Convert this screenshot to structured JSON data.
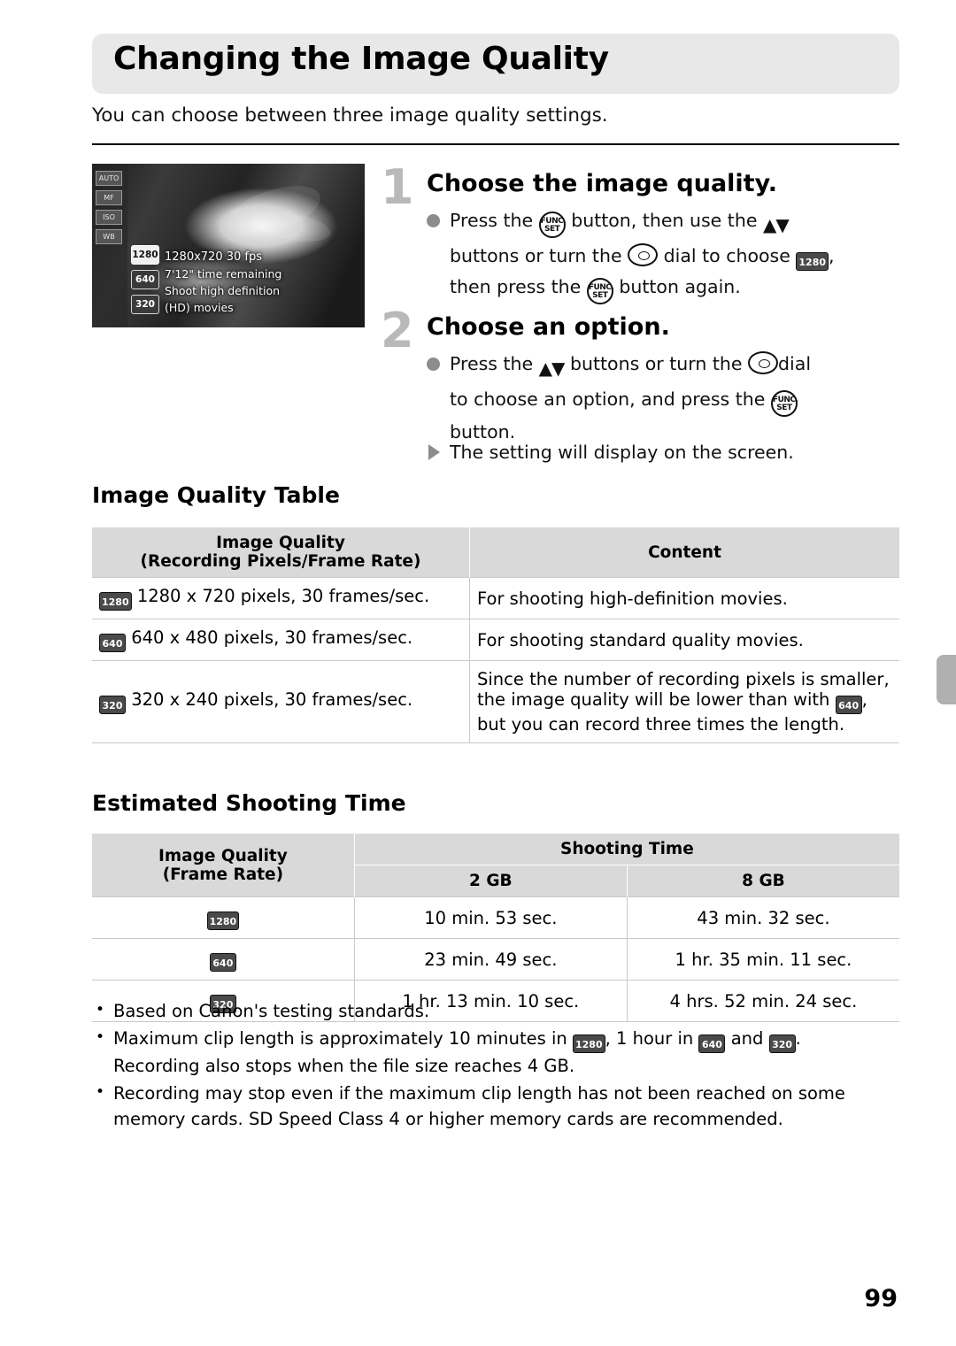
{
  "page": {
    "title": "Changing the Image Quality",
    "intro": "You can choose between three image quality settings.",
    "page_number": "99"
  },
  "screenshot": {
    "osd_line1": "1280x720 30 fps",
    "osd_line2": "7'12\" time remaining",
    "osd_line3": "Shoot high definition",
    "osd_line4": "(HD) movies",
    "quality_badges": [
      "1280",
      "640",
      "320"
    ],
    "side_icons": [
      "AUTO",
      "MF",
      "ISO",
      "WB"
    ]
  },
  "steps": [
    {
      "number": "1",
      "heading": "Choose the image quality.",
      "body_parts": {
        "p1": "Press the",
        "p2": "button, then use the",
        "p3": "buttons or turn the",
        "p4": "dial to choose",
        "p5": ",",
        "p6": "then press the",
        "p7": "button again."
      }
    },
    {
      "number": "2",
      "heading": "Choose an option.",
      "body_parts": {
        "p1": "Press the",
        "p2": "buttons or turn the",
        "p3": "dial",
        "p4": "to choose an option, and press the",
        "p5": "button.",
        "p6": "The setting will display on the screen."
      }
    }
  ],
  "quality_section": {
    "heading": "Image Quality Table",
    "headers": {
      "col1_line1": "Image Quality",
      "col1_line2": "(Recording Pixels/Frame Rate)",
      "col2": "Content"
    },
    "rows": [
      {
        "badge": "1280",
        "spec": "1280 x 720 pixels, 30 frames/sec.",
        "content": "For shooting high-definition movies."
      },
      {
        "badge": "640",
        "spec": "640 x 480 pixels, 30 frames/sec.",
        "content": "For shooting standard quality movies."
      },
      {
        "badge": "320",
        "spec": "320 x 240 pixels, 30 frames/sec.",
        "content_a": "Since the number of recording pixels is smaller, the image quality will be lower than with",
        "content_badge": "640",
        "content_b": ", but you can record three times the length."
      }
    ]
  },
  "time_section": {
    "heading": "Estimated Shooting Time",
    "headers": {
      "col1_line1": "Image Quality",
      "col1_line2": "(Frame Rate)",
      "group": "Shooting Time",
      "sub1": "2 GB",
      "sub2": "8 GB"
    },
    "rows": [
      {
        "badge": "1280",
        "gb2": "10 min. 53 sec.",
        "gb8": "43 min. 32 sec."
      },
      {
        "badge": "640",
        "gb2": "23 min. 49 sec.",
        "gb8": "1 hr. 35 min. 11 sec."
      },
      {
        "badge": "320",
        "gb2": "1 hr. 13 min. 10 sec.",
        "gb8": "4 hrs. 52 min. 24 sec."
      }
    ]
  },
  "notes": {
    "note1": "Based on Canon's testing standards.",
    "note2_a": "Maximum clip length is approximately 10 minutes in",
    "note2_badge1": "1280",
    "note2_b": ", 1 hour in",
    "note2_badge2": "640",
    "note2_c": "and",
    "note2_badge3": "320",
    "note2_d": ".",
    "note2_e": "Recording also stops when the file size reaches 4 GB.",
    "note3": "Recording may stop even if the maximum clip length has not been reached on some memory cards. SD Speed Class 4 or higher memory cards are recommended."
  }
}
